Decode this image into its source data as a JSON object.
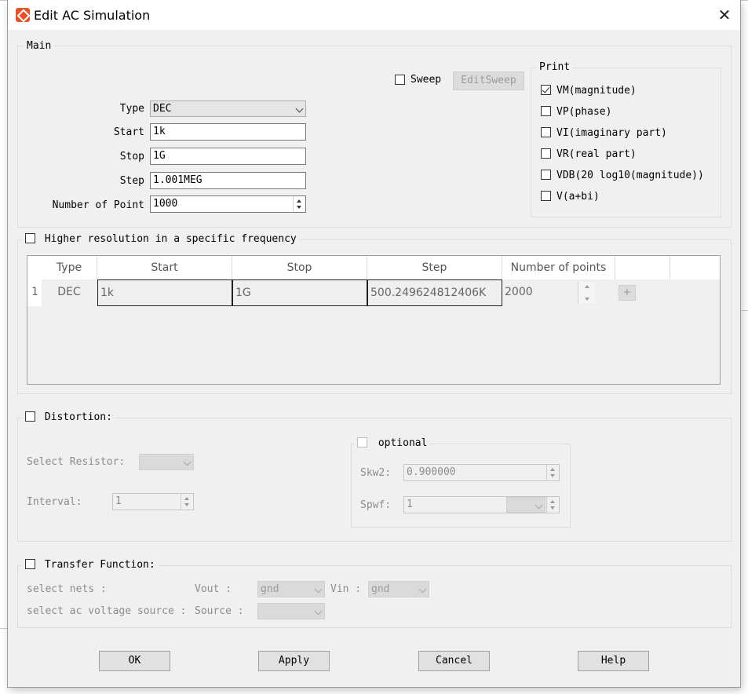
{
  "window": {
    "title": "Edit AC Simulation"
  },
  "main": {
    "legend": "Main",
    "sweep_label": "Sweep",
    "edit_sweep_label": "EditSweep",
    "type_label": "Type",
    "type_value": "DEC",
    "start_label": "Start",
    "start_value": "1k",
    "stop_label": "Stop",
    "stop_value": "1G",
    "step_label": "Step",
    "step_value": "1.001MEG",
    "points_label": "Number of Point",
    "points_value": "1000"
  },
  "print": {
    "legend": "Print",
    "items": [
      {
        "label": "VM(magnitude)",
        "checked": true
      },
      {
        "label": "VP(phase)",
        "checked": false
      },
      {
        "label": "VI(imaginary part)",
        "checked": false
      },
      {
        "label": "VR(real part)",
        "checked": false
      },
      {
        "label": "VDB(20 log10(magnitude))",
        "checked": false
      },
      {
        "label": "V(a+bi)",
        "checked": false
      }
    ]
  },
  "higher_res": {
    "label": "Higher resolution in a specific frequency",
    "columns": [
      "Type",
      "Start",
      "Stop",
      "Step",
      "Number of points"
    ],
    "rows": [
      {
        "index": "1",
        "type": "DEC",
        "start": "1k",
        "stop": "1G",
        "step": "500.249624812406K",
        "points": "2000"
      }
    ],
    "add_label": "+"
  },
  "distortion": {
    "label": "Distortion:",
    "select_resistor_label": "Select Resistor:",
    "interval_label": "Interval:",
    "interval_value": "1",
    "optional_label": "optional",
    "skw2_label": "Skw2:",
    "skw2_value": "0.900000",
    "spwf_label": "Spwf:",
    "spwf_value": "1"
  },
  "transfer": {
    "label": "Transfer Function:",
    "select_nets_label": "select nets :",
    "vout_label": "Vout :",
    "vout_value": "gnd",
    "vin_label": "Vin :",
    "vin_value": "gnd",
    "select_source_label": "select ac voltage source :",
    "source_label": "Source :"
  },
  "buttons": {
    "ok": "OK",
    "apply": "Apply",
    "cancel": "Cancel",
    "help": "Help"
  }
}
